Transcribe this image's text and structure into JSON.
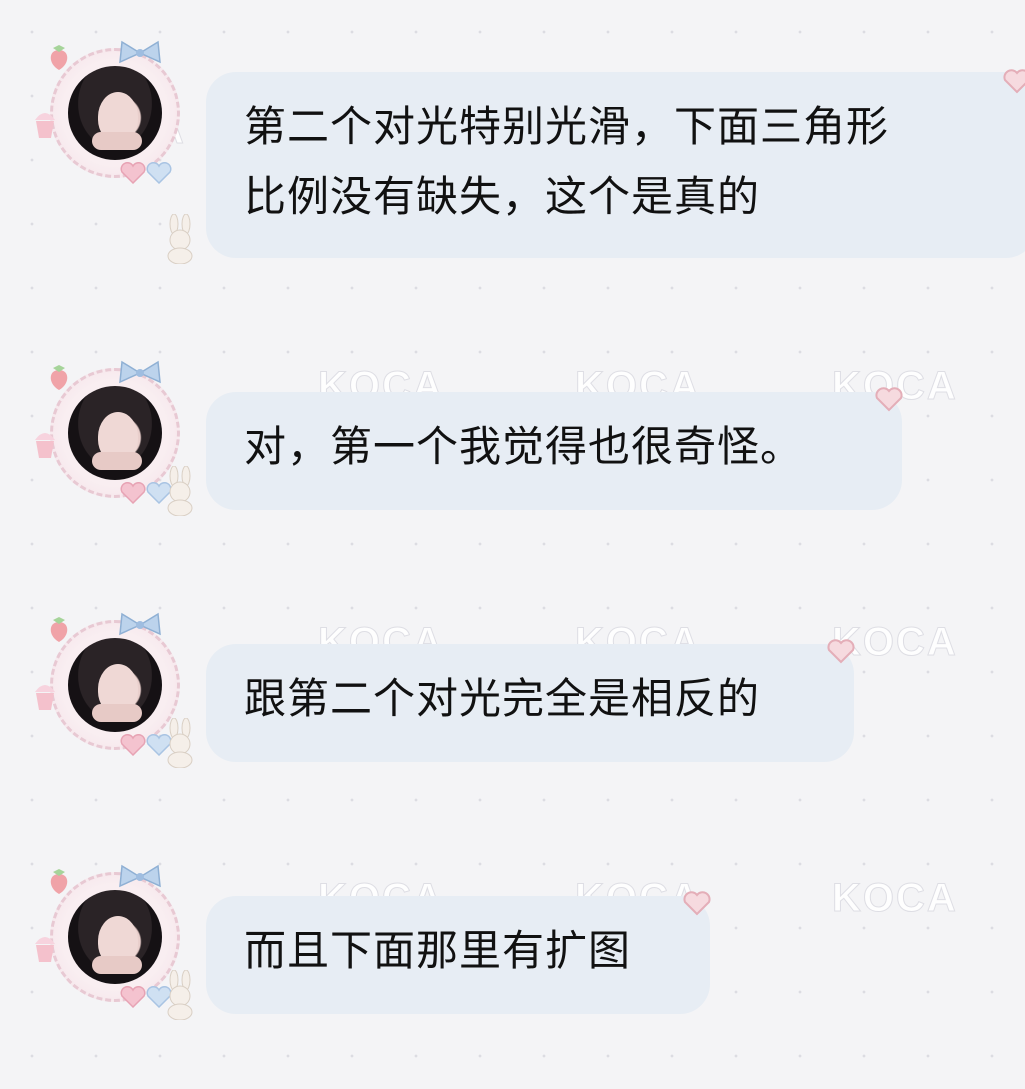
{
  "watermark_text": "KOCA",
  "messages": [
    {
      "text": "第二个对光特别光滑，下面三角形\n比例没有缺失，这个是真的"
    },
    {
      "text": "对，第一个我觉得也很奇怪。"
    },
    {
      "text": "跟第二个对光完全是相反的"
    },
    {
      "text": "而且下面那里有扩图"
    }
  ],
  "colors": {
    "background": "#f4f4f6",
    "bubble": "#e7edf4",
    "text": "#111111"
  }
}
